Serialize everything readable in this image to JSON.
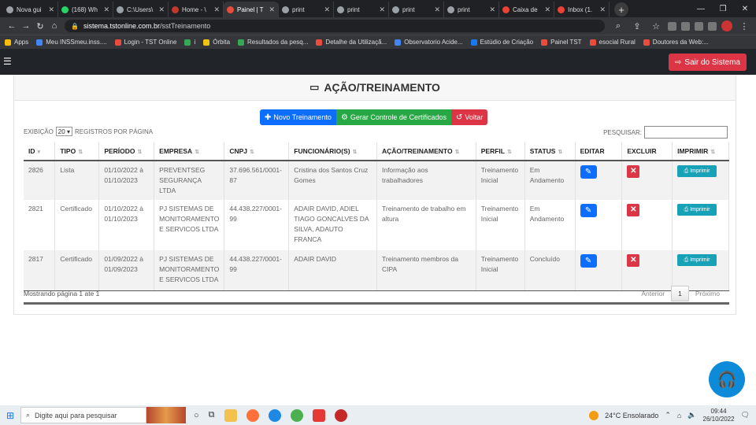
{
  "browser": {
    "tabs": [
      {
        "label": "Nova gui",
        "color": "#9aa0a6"
      },
      {
        "label": "(168) Wh",
        "color": "#25d366"
      },
      {
        "label": "C:\\Users\\",
        "color": "#9aa0a6"
      },
      {
        "label": "Home - \\",
        "color": "#c0392b"
      },
      {
        "label": "Painel | T",
        "color": "#e74c3c"
      },
      {
        "label": "print",
        "color": "#9aa0a6"
      },
      {
        "label": "print",
        "color": "#9aa0a6"
      },
      {
        "label": "print",
        "color": "#9aa0a6"
      },
      {
        "label": "print",
        "color": "#9aa0a6"
      },
      {
        "label": "Caixa de",
        "color": "#ea4335"
      },
      {
        "label": "Inbox (1.",
        "color": "#ea4335"
      }
    ],
    "active_tab": 4,
    "url_host": "sistema.tstonline.com.br",
    "url_path": "/sstTreinamento",
    "bookmarks": [
      {
        "label": "Apps",
        "color": "#fbbc05"
      },
      {
        "label": "Meu INSSmeu.inss....",
        "color": "#4285f4"
      },
      {
        "label": "Login - TST Online",
        "color": "#e74c3c"
      },
      {
        "label": "i",
        "color": "#34a853"
      },
      {
        "label": "Órbita",
        "color": "#f1c40f"
      },
      {
        "label": "Resultados da pesq...",
        "color": "#34a853"
      },
      {
        "label": "Detalhe da Utilizaçã...",
        "color": "#e74c3c"
      },
      {
        "label": "Observatorio Acide...",
        "color": "#4285f4"
      },
      {
        "label": "Estúdio de Criação",
        "color": "#1877f2"
      },
      {
        "label": "Painel TST",
        "color": "#e74c3c"
      },
      {
        "label": "esocial Rural",
        "color": "#e74c3c"
      },
      {
        "label": "Doutores da Web:...",
        "color": "#e74c3c"
      }
    ]
  },
  "header": {
    "logout_label": "Sair do Sistema"
  },
  "page": {
    "title": "AÇÃO/TREINAMENTO",
    "buttons": {
      "new": "Novo Treinamento",
      "certificates": "Gerar Controle de Certificados",
      "back": "Voltar"
    },
    "length": {
      "prefix": "EXIBIÇÃO",
      "value": "20",
      "suffix": "REGISTROS POR PÁGINA"
    },
    "search_label": "PESQUISAR:",
    "search_value": "",
    "columns": [
      "ID",
      "TIPO",
      "PERÍODO",
      "EMPRESA",
      "CNPJ",
      "FUNCIONÁRIO(S)",
      "AÇÃO/TREINAMENTO",
      "PERFIL",
      "STATUS",
      "EDITAR",
      "EXCLUIR",
      "IMPRIMIR"
    ],
    "rows": [
      {
        "id": "2826",
        "tipo": "Lista",
        "periodo": "01/10/2022 à 01/10/2023",
        "empresa": "PREVENTSEG SEGURANÇA LTDA",
        "cnpj": "37.696.561/0001-87",
        "funcionarios": "Cristina dos Santos Cruz Gomes",
        "acao": "Informação aos trabalhadores",
        "perfil": "Treinamento Inicial",
        "status": "Em Andamento",
        "print_label": "Imprimir"
      },
      {
        "id": "2821",
        "tipo": "Certificado",
        "periodo": "01/10/2022 à 01/10/2023",
        "empresa": "PJ SISTEMAS DE MONITORAMENTO E SERVICOS LTDA",
        "cnpj": "44.438.227/0001-99",
        "funcionarios": "ADAIR DAVID, ADIEL TIAGO GONCALVES DA SILVA, ADAUTO FRANCA",
        "acao": "Treinamento de trabalho em altura",
        "perfil": "Treinamento Inicial",
        "status": "Em Andamento",
        "print_label": "Imprimir"
      },
      {
        "id": "2817",
        "tipo": "Certificado",
        "periodo": "01/09/2022 à 01/09/2023",
        "empresa": "PJ SISTEMAS DE MONITORAMENTO E SERVICOS LTDA",
        "cnpj": "44.438.227/0001-99",
        "funcionarios": "ADAIR DAVID",
        "acao": "Treinamento membros da CIPA",
        "perfil": "Treinamento Inicial",
        "status": "Concluído",
        "print_label": "Imprimir"
      }
    ],
    "info": "Mostrando página 1 ate 1",
    "pager": {
      "prev": "Anterior",
      "current": "1",
      "next": "Próximo"
    }
  },
  "taskbar": {
    "search_placeholder": "Digite aqui para pesquisar",
    "weather": "24°C Ensolarado",
    "time": "09:44",
    "date": "26/10/2022"
  }
}
